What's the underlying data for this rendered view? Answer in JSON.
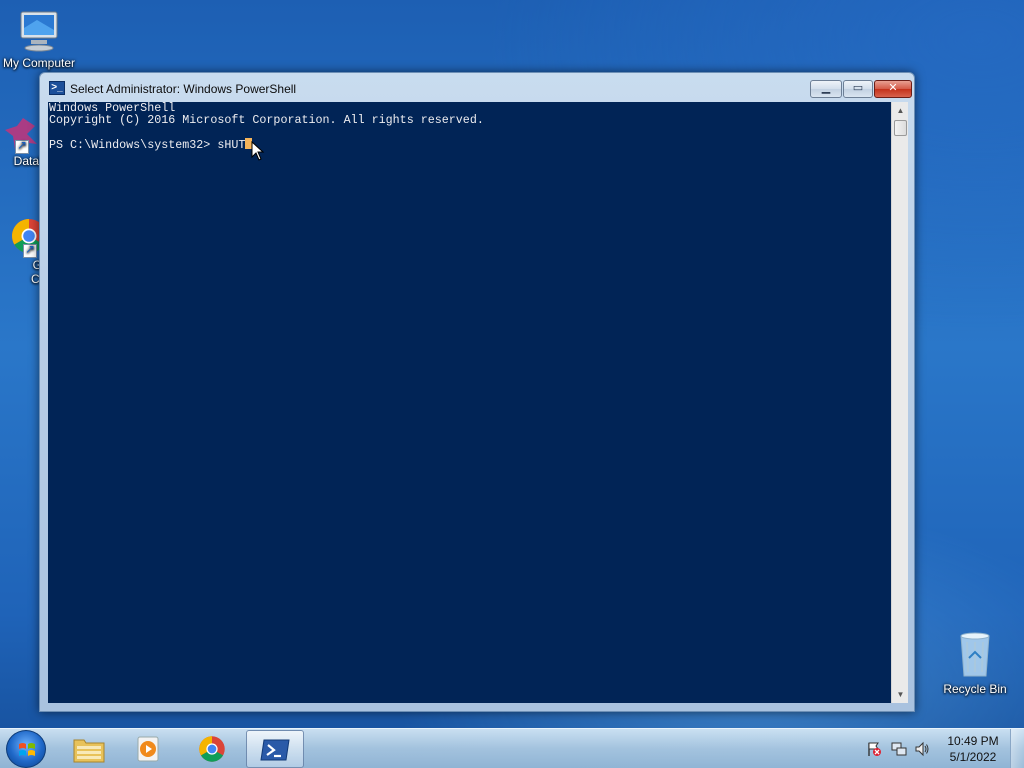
{
  "desktop": {
    "icons": [
      {
        "label": "My Computer",
        "icon": "computer-icon"
      },
      {
        "label": "DataW",
        "icon": "datawedge-icon"
      },
      {
        "label": "Goo",
        "label2": "Chro",
        "icon": "chrome-icon"
      },
      {
        "label": "Recycle Bin",
        "icon": "recycle-bin-icon"
      }
    ]
  },
  "window": {
    "title": "Select Administrator: Windows PowerShell",
    "minimize": "▁",
    "maximize": "▭",
    "close": "✕",
    "console": {
      "lines": [
        "Windows PowerShell",
        "Copyright (C) 2016 Microsoft Corporation. All rights reserved.",
        "",
        "PS C:\\Windows\\system32> sHUT"
      ]
    }
  },
  "taskbar": {
    "pinned": [
      {
        "name": "windows-explorer",
        "icon": "folder-icon"
      },
      {
        "name": "media-player",
        "icon": "media-player-icon"
      },
      {
        "name": "google-chrome",
        "icon": "chrome-icon"
      },
      {
        "name": "powershell",
        "icon": "powershell-icon",
        "active": true
      }
    ],
    "clock": {
      "time": "10:49 PM",
      "date": "5/1/2022"
    }
  },
  "colors": {
    "console_bg": "#012456",
    "console_fg": "#eeedf0",
    "cursor": "#f5b45a",
    "desktop_blue": "#2a77c9"
  }
}
